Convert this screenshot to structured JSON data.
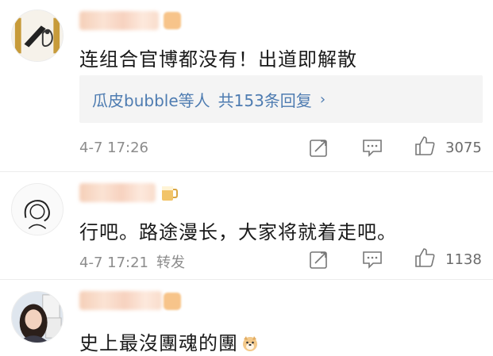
{
  "comments": [
    {
      "text": "连组合官博都没有！出道即解散",
      "reply": {
        "users_label": "瓜皮bubble等人",
        "count_label": "共153条回复",
        "chevron": "›"
      },
      "time": "4-7 17:26",
      "likes": "3075",
      "icons": {
        "repost": "repost-icon",
        "comment": "comment-icon",
        "like": "like-icon"
      }
    },
    {
      "text": "行吧。路途漫长，大家将就着走吧。",
      "time": "4-7 17:21",
      "repost_label": "转发",
      "likes": "1138",
      "icons": {
        "repost": "repost-icon",
        "comment": "comment-icon",
        "like": "like-icon"
      }
    },
    {
      "text": "史上最沒團魂的團",
      "emoji": "doge-emoji"
    }
  ],
  "colors": {
    "link": "#4e7cb1",
    "meta": "#8c8c8c",
    "reply_bg": "#f4f4f4"
  }
}
